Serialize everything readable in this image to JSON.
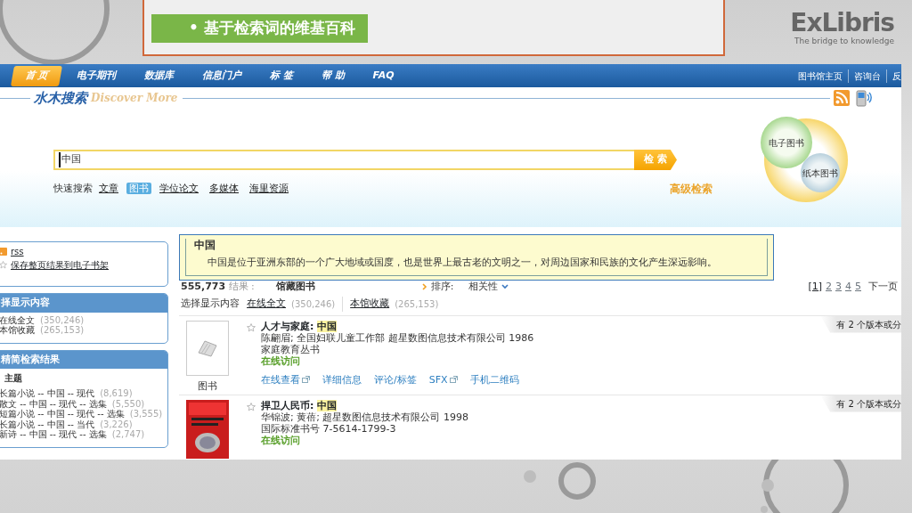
{
  "slide": {
    "title_bullet": "•",
    "title": "基于检索词的维基百科",
    "logo_name": "ExLibris",
    "logo_tagline": "The bridge to knowledge"
  },
  "nav": {
    "tabs": [
      {
        "label": "首 页",
        "selected": true
      },
      {
        "label": "电子期刊",
        "selected": false
      },
      {
        "label": "数据库",
        "selected": false
      },
      {
        "label": "信息门户",
        "selected": false
      },
      {
        "label": "标 签",
        "selected": false
      },
      {
        "label": "帮 助",
        "selected": false
      },
      {
        "label": "FAQ",
        "selected": false
      }
    ],
    "links": [
      "图书馆主页",
      "咨询台",
      "反"
    ]
  },
  "header": {
    "logo_cn": "水木搜索",
    "logo_en": "Discover More",
    "search_value": "中国",
    "search_button": "检 索",
    "quick_label": "快速搜索",
    "quick_options": [
      {
        "label": "文章",
        "selected": false
      },
      {
        "label": "图书",
        "selected": true
      },
      {
        "label": "学位论文",
        "selected": false
      },
      {
        "label": "多媒体",
        "selected": false
      },
      {
        "label": "海里资源",
        "selected": false
      }
    ],
    "advanced": "高级检索",
    "venn": [
      "电子图书",
      "纸本图书"
    ]
  },
  "sidebar": {
    "actions": [
      {
        "kind": "rss",
        "label": "rss"
      },
      {
        "kind": "star",
        "label": "保存整页结果到电子书架"
      }
    ],
    "panels": [
      {
        "title": "择显示内容",
        "groups": [
          {
            "items": [
              {
                "label": "在线全文",
                "count": "(350,246)"
              },
              {
                "label": "本馆收藏",
                "count": "(265,153)"
              }
            ]
          }
        ]
      },
      {
        "title": "精简检索结果",
        "groups": [
          {
            "title": "主题",
            "items": [
              {
                "label": "长篇小说 -- 中国 -- 现代",
                "count": "(8,619)"
              },
              {
                "label": "散文 -- 中国 -- 现代 -- 选集",
                "count": "(5,550)"
              },
              {
                "label": "短篇小说 -- 中国 -- 现代 -- 选集",
                "count": "(3,555)"
              },
              {
                "label": "长篇小说 -- 中国 -- 当代",
                "count": "(3,226)"
              },
              {
                "label": "新诗 -- 中国 -- 现代 -- 选集",
                "count": "(2,747)"
              }
            ]
          }
        ]
      }
    ]
  },
  "wiki": {
    "title": "中国",
    "text": "中国是位于亚洲东部的一个广大地域或国度，也是世界上最古老的文明之一，对周边国家和民族的文化产生深远影响。"
  },
  "results": {
    "count": "555,773",
    "count_label": "结果 :",
    "scope": "馆藏图书",
    "sort_label": "排序:",
    "sort_value": "相关性",
    "pages": [
      {
        "label": "[1]",
        "selected": true
      },
      {
        "label": "2",
        "selected": false
      },
      {
        "label": "3",
        "selected": false
      },
      {
        "label": "4",
        "selected": false
      },
      {
        "label": "5",
        "selected": false
      }
    ],
    "next": "下一页",
    "filter_label": "选择显示内容",
    "filters": [
      {
        "label": "在线全文",
        "count": "(350,246)"
      },
      {
        "label": "本馆收藏",
        "count": "(265,153)"
      }
    ],
    "items": [
      {
        "kind": "placeholder",
        "thumb_label": "图书",
        "title": "人才与家庭:",
        "title_match": "中国",
        "lines": [
          "陈翩眉; 全国妇联儿童工作部 超星数图信息技术有限公司 1986",
          "家庭教育丛书"
        ],
        "access": "在线访问",
        "links": [
          {
            "label": "在线查看",
            "external": true
          },
          {
            "label": "详细信息",
            "external": false
          },
          {
            "label": "评论/标签",
            "external": false
          },
          {
            "label": "SFX",
            "external": true
          },
          {
            "label": "手机二维码",
            "external": false
          }
        ],
        "versions": "有 2 个版本或分"
      },
      {
        "kind": "picture",
        "title": "捍卫人民币:",
        "title_match": "中国",
        "lines": [
          "华锦波; 黄蓓; 超星数图信息技术有限公司 1998",
          "国际标准书号 7-5614-1799-3"
        ],
        "access": "在线访问",
        "versions": "有 2 个版本或分"
      }
    ]
  }
}
